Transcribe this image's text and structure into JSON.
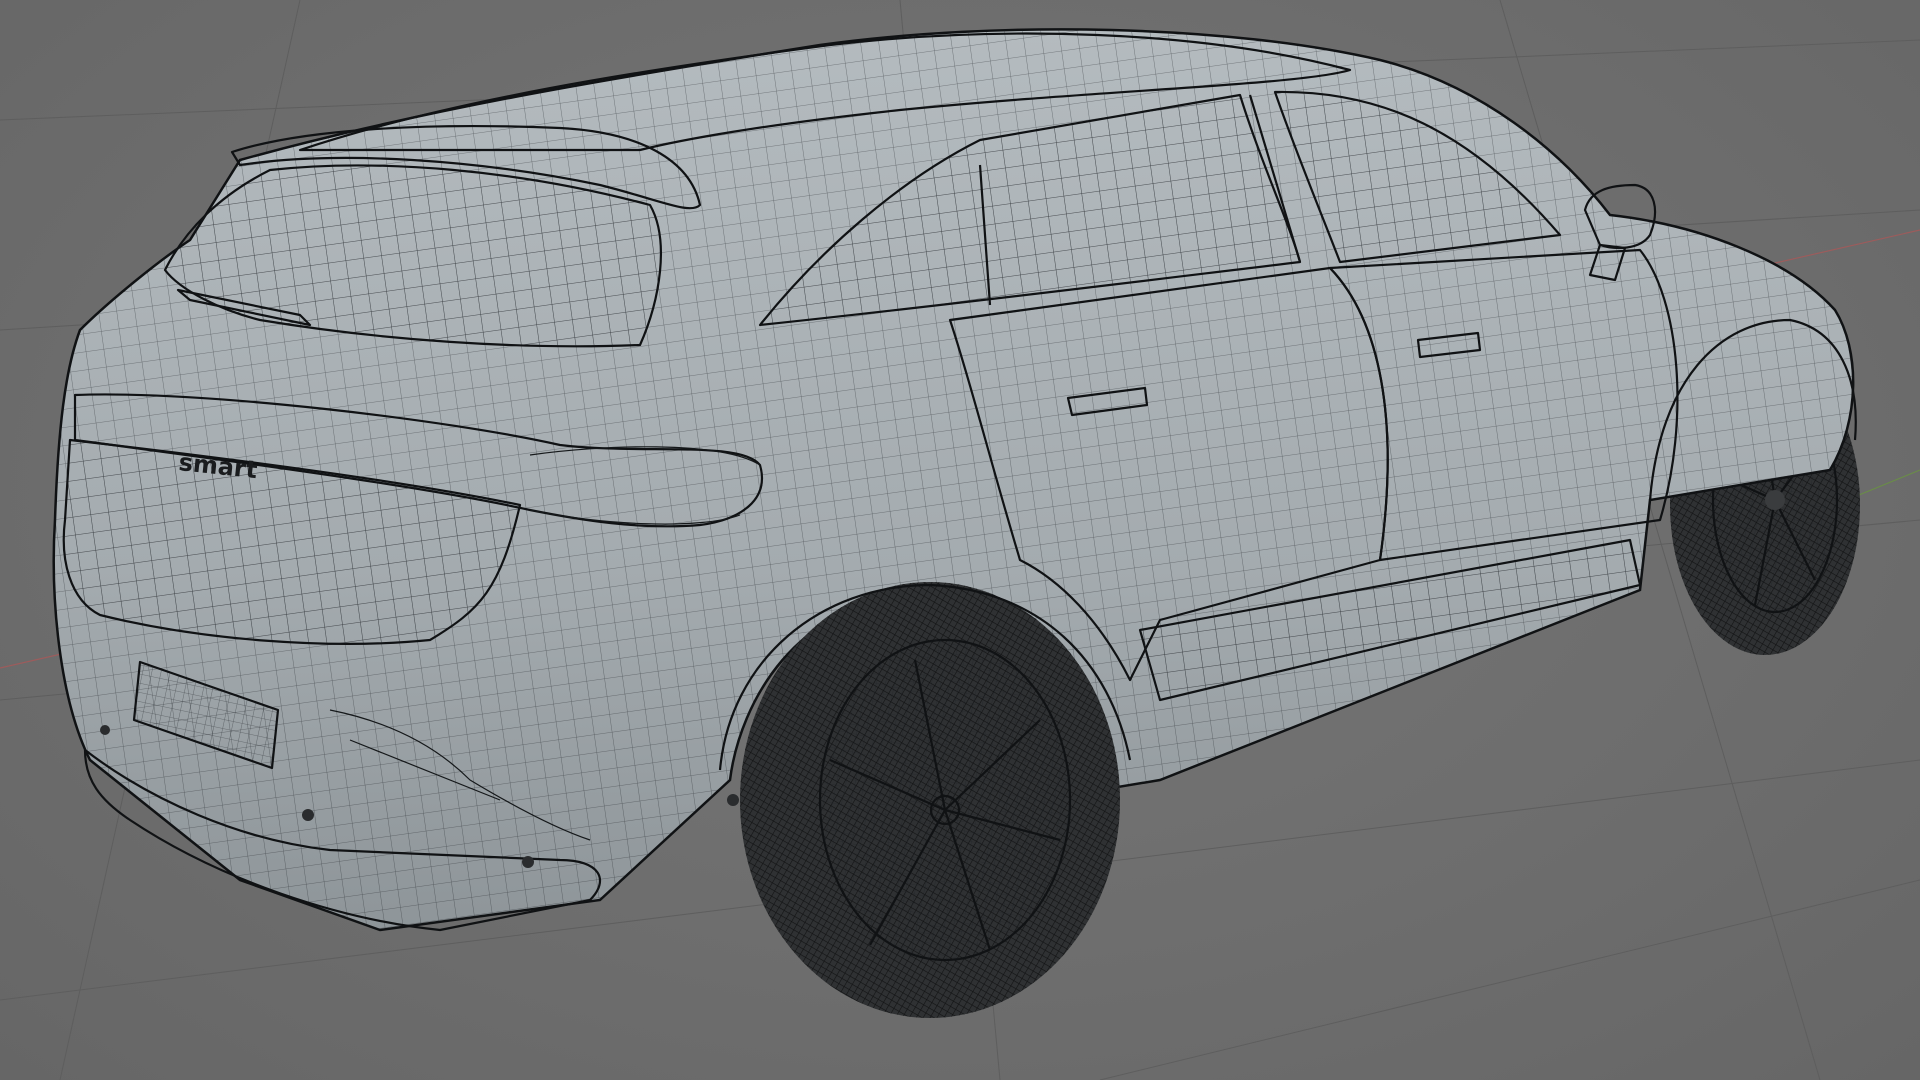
{
  "viewport": {
    "background_color": "#707070",
    "grid_color": "#5e5e5e",
    "axis_x_color": "#c05050",
    "axis_y_color": "#6a9a3a",
    "shading": "wireframe-overlay"
  },
  "model": {
    "object": "car-body",
    "body_color": "#a9b0b4",
    "glass_color": "#9aa3a8",
    "tire_color": "#303234",
    "wire_color": "#1c1f22",
    "badge_text": "smart"
  }
}
